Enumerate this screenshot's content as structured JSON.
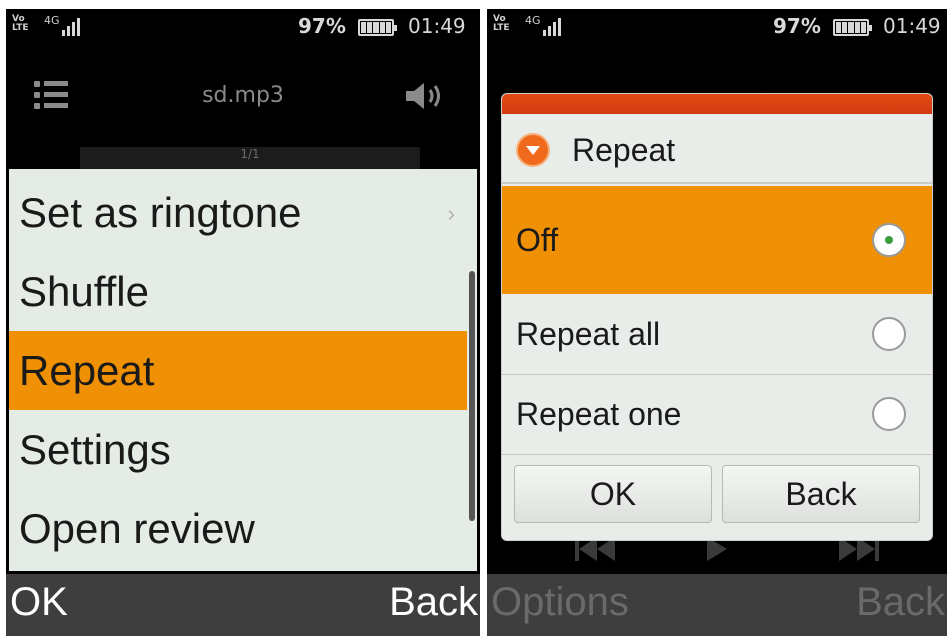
{
  "status_bar": {
    "volte": "Vo\nLTE",
    "network": "4G",
    "battery_percent": "97%",
    "time": "01:49",
    "battery_level": 1.0
  },
  "player": {
    "title": "sd.mp3",
    "track_counter": "1/1",
    "menu_icon": "list-icon",
    "volume_icon": "speaker-icon"
  },
  "options_menu": {
    "items": [
      {
        "label": "Set as ringtone",
        "has_submenu": true
      },
      {
        "label": "Shuffle"
      },
      {
        "label": "Repeat",
        "selected": true
      },
      {
        "label": "Settings"
      },
      {
        "label": "Open review"
      }
    ]
  },
  "left_softkeys": {
    "left": "OK",
    "right": "Back"
  },
  "repeat_dialog": {
    "title": "Repeat",
    "icon": "chevron-down-circle-icon",
    "options": [
      {
        "label": "Off",
        "checked": true
      },
      {
        "label": "Repeat all",
        "checked": false
      },
      {
        "label": "Repeat one",
        "checked": false
      }
    ],
    "ok_label": "OK",
    "back_label": "Back"
  },
  "right_softkeys": {
    "left": "Options",
    "right": "Back"
  },
  "colors": {
    "highlight": "#f09004",
    "dialog_strip": "#e24a12",
    "menu_bg": "#e5ebe5",
    "softkey_bar": "#3e3e3e"
  }
}
